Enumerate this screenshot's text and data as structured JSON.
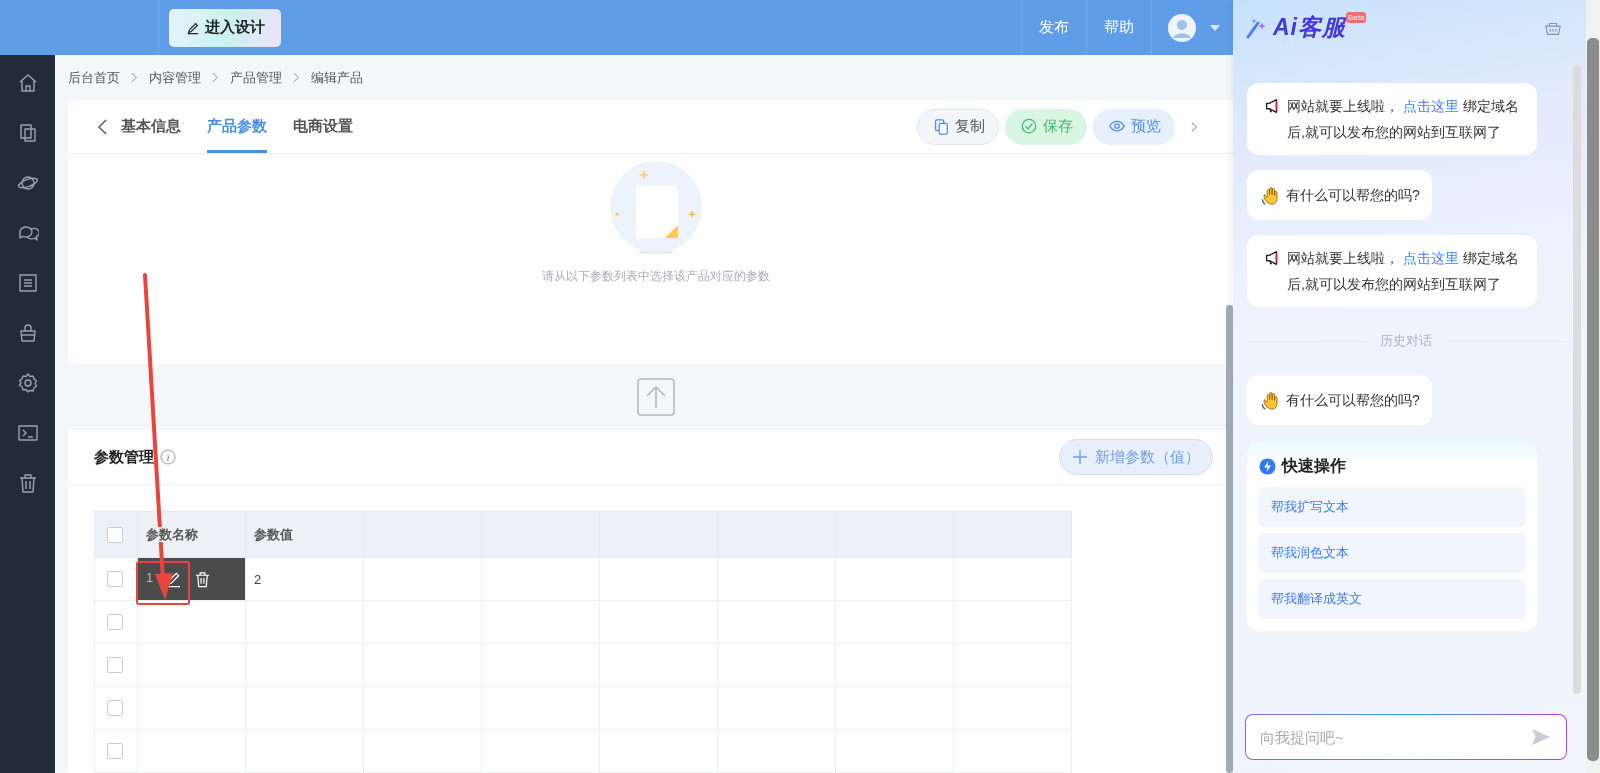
{
  "top_bar": {
    "design_button": "进入设计",
    "menu": [
      "发布",
      "帮助"
    ]
  },
  "breadcrumb": [
    "后台首页",
    "内容管理",
    "产品管理",
    "编辑产品"
  ],
  "tabs": [
    {
      "label": "基本信息",
      "selected": false
    },
    {
      "label": "产品参数",
      "selected": true
    },
    {
      "label": "电商设置",
      "selected": false
    }
  ],
  "actions": [
    {
      "label": "复制",
      "kind": "copy"
    },
    {
      "label": "保存",
      "kind": "save"
    },
    {
      "label": "预览",
      "kind": "preview"
    }
  ],
  "empty_state": {
    "message": "请从以下参数列表中选择该产品对应的参数"
  },
  "params": {
    "title": "参数管理",
    "add_button": "新增参数（值）",
    "columns": [
      "参数名称",
      "参数值"
    ],
    "all_checked": false,
    "rows": [
      {
        "checked": false,
        "hovered": true,
        "name": "1",
        "value": "2"
      },
      {
        "checked": false,
        "hovered": false
      },
      {
        "checked": false,
        "hovered": false
      },
      {
        "checked": false,
        "hovered": false
      },
      {
        "checked": false,
        "hovered": false
      }
    ]
  },
  "ai_panel": {
    "title": "Ai客服",
    "badge": "Beta",
    "messages": [
      {
        "kind": "notice",
        "text": "网站就要上线啦，",
        "link": "点击这里",
        "after": "绑定域名后,就可以发布您的网站到互联网了"
      },
      {
        "kind": "greeting",
        "text": "有什么可以帮您的吗?"
      },
      {
        "kind": "notice",
        "text": "网站就要上线啦，",
        "link": "点击这里",
        "after": "绑定域名后,就可以发布您的网站到互联网了"
      },
      {
        "kind": "divider",
        "text": "历史对话"
      },
      {
        "kind": "greeting",
        "text": "有什么可以帮您的吗?"
      },
      {
        "kind": "quick",
        "title": "快速操作",
        "items": [
          "帮我扩写文本",
          "帮我润色文本",
          "帮我翻译成英文"
        ]
      }
    ],
    "input": {
      "placeholder": "向我提问吧~"
    }
  }
}
